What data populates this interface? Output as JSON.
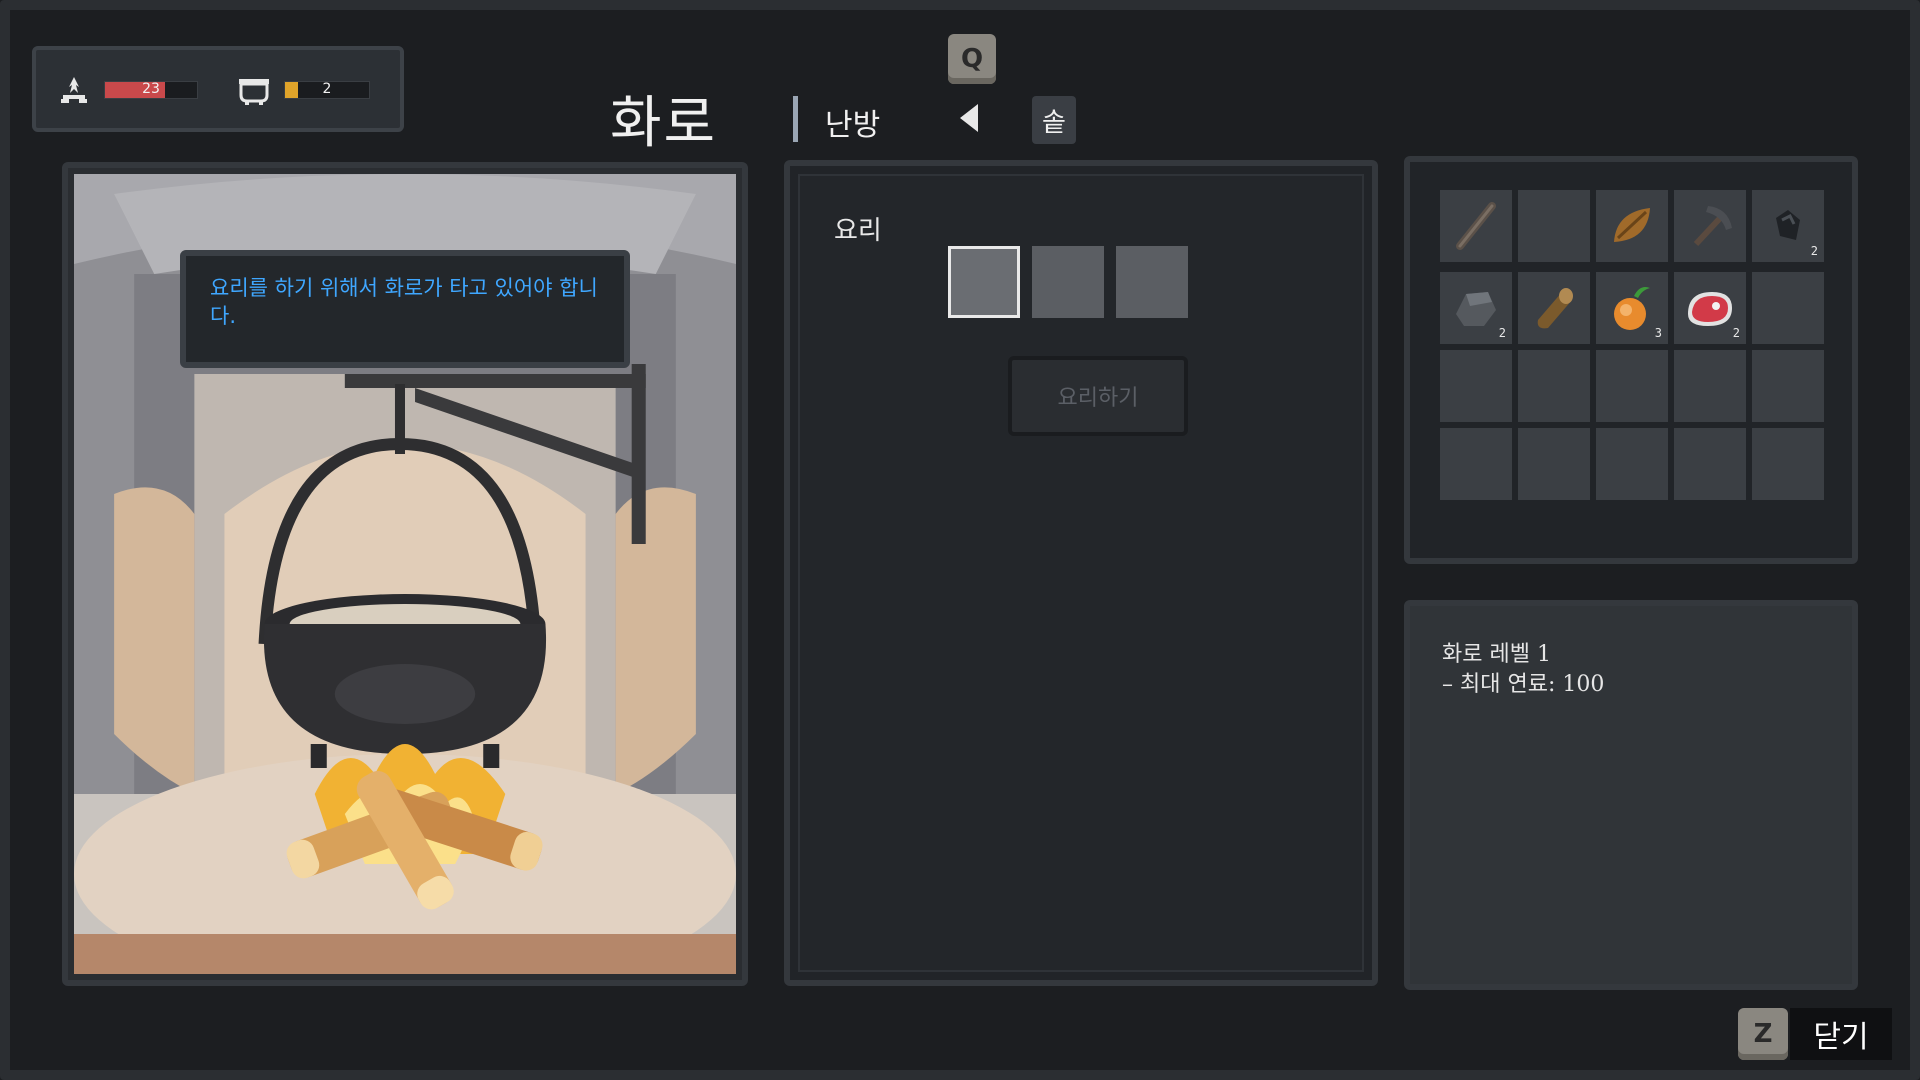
{
  "hud": {
    "fire_value": "23",
    "fire_level": 0.65,
    "fuel_value": "2",
    "fuel_level": 0.15,
    "fire_icon": "campfire-icon",
    "pot_icon": "pot-icon",
    "fire_color": "#c9494b",
    "fuel_color": "#e0a42a"
  },
  "header": {
    "title": "화로",
    "tab_label": "난방",
    "prev_key": "Q",
    "side_button": "솥"
  },
  "tooltip": {
    "text": "요리를 하기 위해서 화로가 타고 있어야 합니다."
  },
  "cooking": {
    "label": "요리",
    "cook_button": "요리하기"
  },
  "inventory": {
    "slots": [
      {
        "icon": "stick-icon",
        "count": ""
      },
      {
        "icon": "",
        "count": ""
      },
      {
        "icon": "seed-icon",
        "count": ""
      },
      {
        "icon": "pickaxe-icon",
        "count": ""
      },
      {
        "icon": "flint-icon",
        "count": "2"
      },
      {
        "icon": "stone-icon",
        "count": "2"
      },
      {
        "icon": "log-icon",
        "count": ""
      },
      {
        "icon": "onion-icon",
        "count": "3"
      },
      {
        "icon": "meat-icon",
        "count": "2"
      },
      {
        "icon": "",
        "count": ""
      }
    ]
  },
  "info": {
    "line1": "화로 레벨 1",
    "line2": "– 최대 연료: 100"
  },
  "footer": {
    "close_key": "Z",
    "close_label": "닫기"
  }
}
